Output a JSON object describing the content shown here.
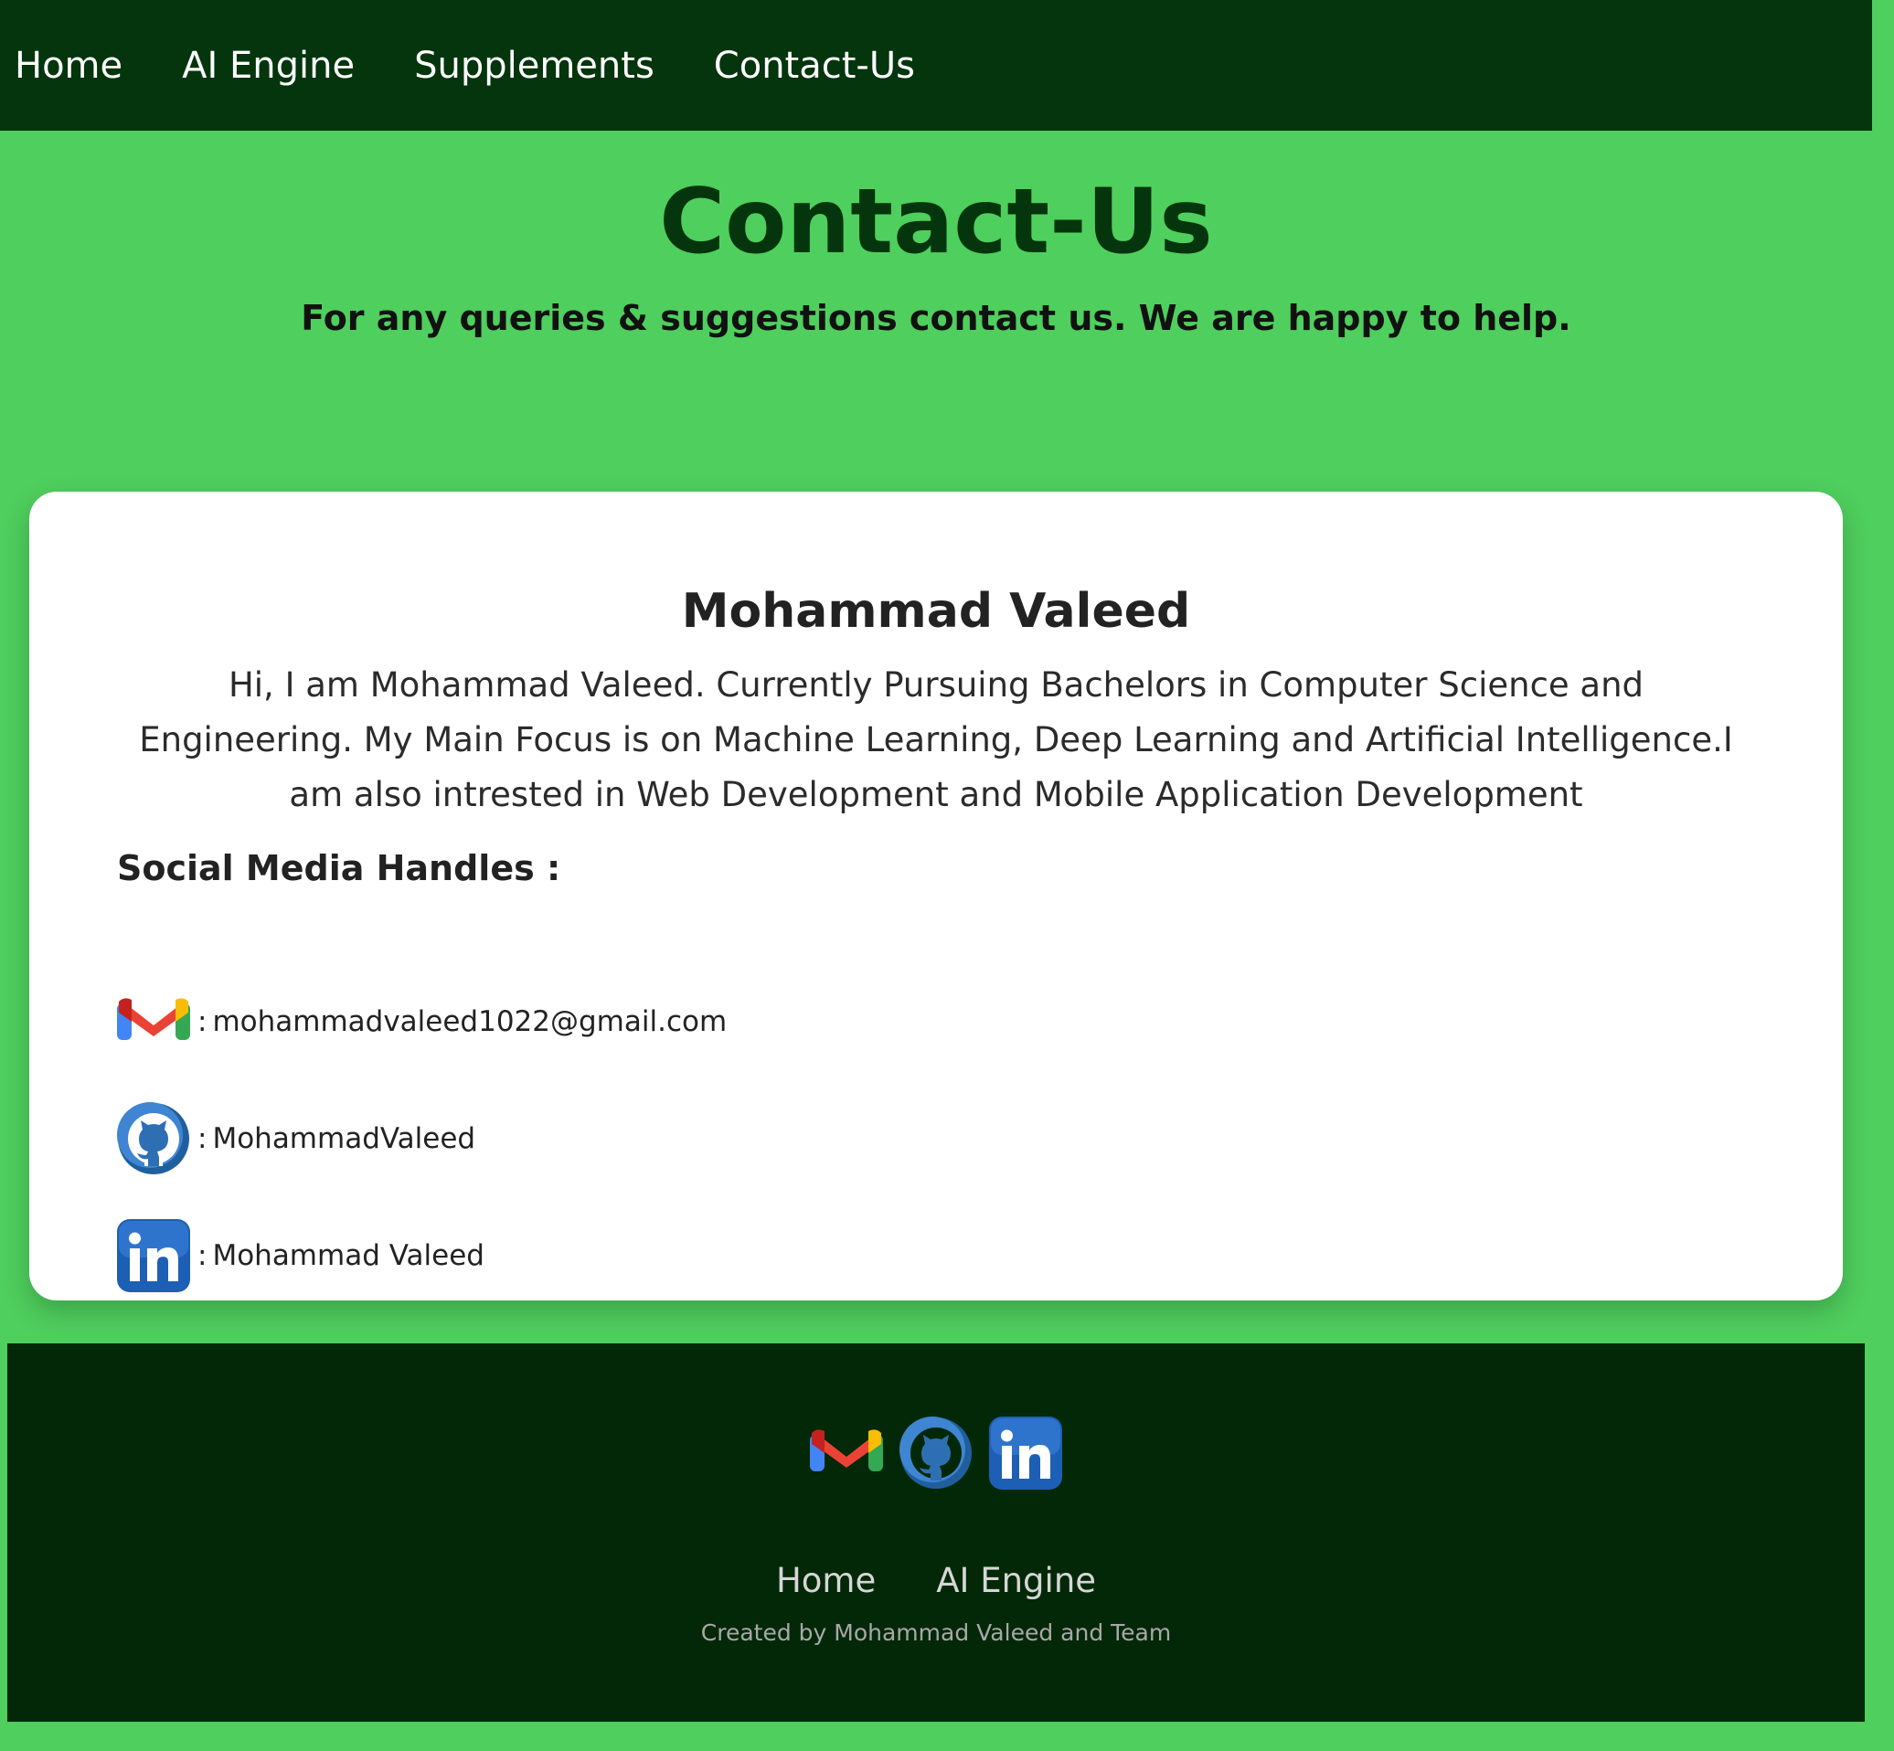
{
  "nav": {
    "items": [
      "Home",
      "AI Engine",
      "Supplements",
      "Contact-Us"
    ]
  },
  "header": {
    "title": "Contact-Us",
    "subtitle": "For any queries & suggestions contact us. We are happy to help."
  },
  "card": {
    "name": "Mohammad Valeed",
    "bio": "Hi, I am Mohammad Valeed. Currently Pursuing Bachelors in Computer Science and Engineering. My Main Focus is on Machine Learning, Deep Learning and Artificial Intelligence.I am also intrested in Web Development and Mobile Application Development",
    "social_heading": "Social Media Handles :",
    "separator": ":",
    "socials": [
      {
        "icon": "gmail-icon",
        "value": "mohammadvaleed1022@gmail.com"
      },
      {
        "icon": "github-icon",
        "value": "MohammadValeed"
      },
      {
        "icon": "linkedin-icon",
        "value": "Mohammad Valeed"
      }
    ]
  },
  "footer": {
    "icons": [
      "gmail-icon",
      "github-icon",
      "linkedin-icon"
    ],
    "links": [
      "Home",
      "AI Engine"
    ],
    "credit": "Created by Mohammad Valeed and Team"
  },
  "colors": {
    "page_background": "#4fcf5d",
    "nav_background": "#04350d",
    "title_color": "#04350d",
    "footer_background": "#032808",
    "card_background": "#ffffff"
  }
}
